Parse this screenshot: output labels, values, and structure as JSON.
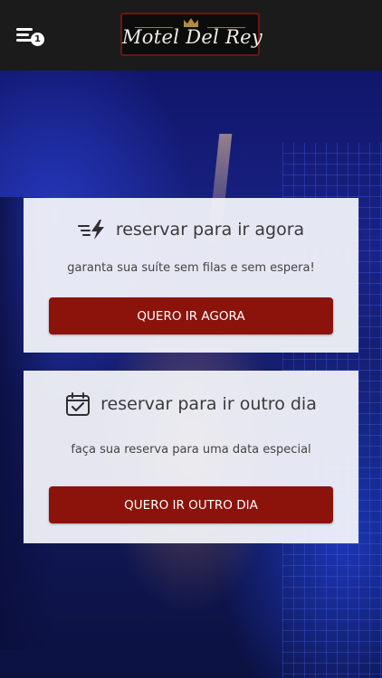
{
  "header": {
    "menu_badge": "1",
    "logo_text": "Motel Del Rey",
    "icons": {
      "menu": "hamburger-menu-icon",
      "crown": "crown-icon"
    }
  },
  "cards": [
    {
      "icon": "fast-lightning-icon",
      "title": "reservar para ir agora",
      "subtitle": "garanta sua suíte sem filas e sem espera!",
      "button": "QUERO IR AGORA"
    },
    {
      "icon": "calendar-check-icon",
      "title": "reservar para ir outro dia",
      "subtitle": "faça sua reserva para uma data especial",
      "button": "QUERO IR OUTRO DIA"
    }
  ],
  "colors": {
    "topbar": "#1b1b1b",
    "button": "#8b130b",
    "card": "#f5f6fb",
    "logo_border": "#6b1612"
  }
}
